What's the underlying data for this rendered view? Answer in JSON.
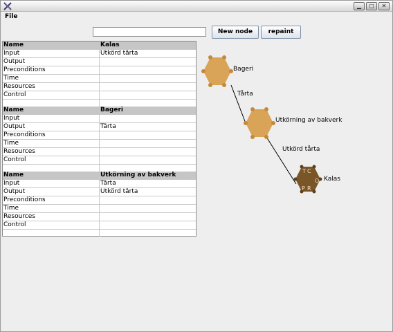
{
  "menu": {
    "file": "File"
  },
  "toolbar": {
    "input_value": "",
    "new_node_label": "New node",
    "repaint_label": "repaint"
  },
  "tables": [
    {
      "header_left": "Name",
      "header_right": "Kalas",
      "rows": [
        [
          "Input",
          "Utkörd tårta"
        ],
        [
          "Output",
          ""
        ],
        [
          "Preconditions",
          ""
        ],
        [
          "Time",
          ""
        ],
        [
          "Resources",
          ""
        ],
        [
          "Control",
          ""
        ]
      ]
    },
    {
      "header_left": "Name",
      "header_right": "Bageri",
      "rows": [
        [
          "Input",
          ""
        ],
        [
          "Output",
          "Tårta"
        ],
        [
          "Preconditions",
          ""
        ],
        [
          "Time",
          ""
        ],
        [
          "Resources",
          ""
        ],
        [
          "Control",
          ""
        ]
      ]
    },
    {
      "header_left": "Name",
      "header_right": "Utkörning av bakverk",
      "rows": [
        [
          "Input",
          "Tårta"
        ],
        [
          "Output",
          "Utkörd tårta"
        ],
        [
          "Preconditions",
          ""
        ],
        [
          "Time",
          ""
        ],
        [
          "Resources",
          ""
        ],
        [
          "Control",
          ""
        ]
      ]
    }
  ],
  "graph": {
    "nodes": [
      {
        "label": "Bageri",
        "color": "#d9a457"
      },
      {
        "label": "Utkörning av bakverk",
        "color": "#d9a457"
      },
      {
        "label": "Kalas",
        "color": "#7a5528",
        "port_letters": [
          "T",
          "C",
          "O",
          "P",
          "R"
        ]
      }
    ],
    "edges": [
      {
        "label": "Tårta"
      },
      {
        "label": "Utkörd tårta"
      }
    ]
  }
}
